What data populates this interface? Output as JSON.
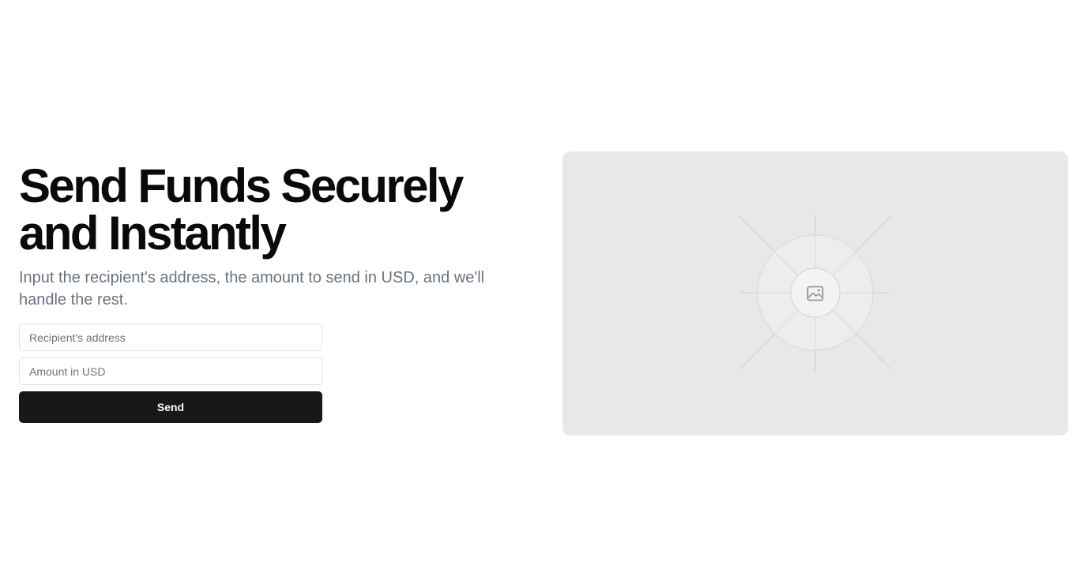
{
  "hero": {
    "headline_line1": "Send Funds Securely",
    "headline_line2": "and Instantly",
    "subtitle": "Input the recipient's address, the amount to send in USD, and we'll handle the rest."
  },
  "form": {
    "address_placeholder": "Recipient's address",
    "address_value": "",
    "amount_placeholder": "Amount in USD",
    "amount_value": "",
    "send_label": "Send"
  },
  "media": {
    "icon": "image-icon"
  },
  "colors": {
    "button_bg": "#18181b",
    "button_text": "#fafafa",
    "subtitle": "#6b7280",
    "panel_bg": "#e8e8e8"
  }
}
